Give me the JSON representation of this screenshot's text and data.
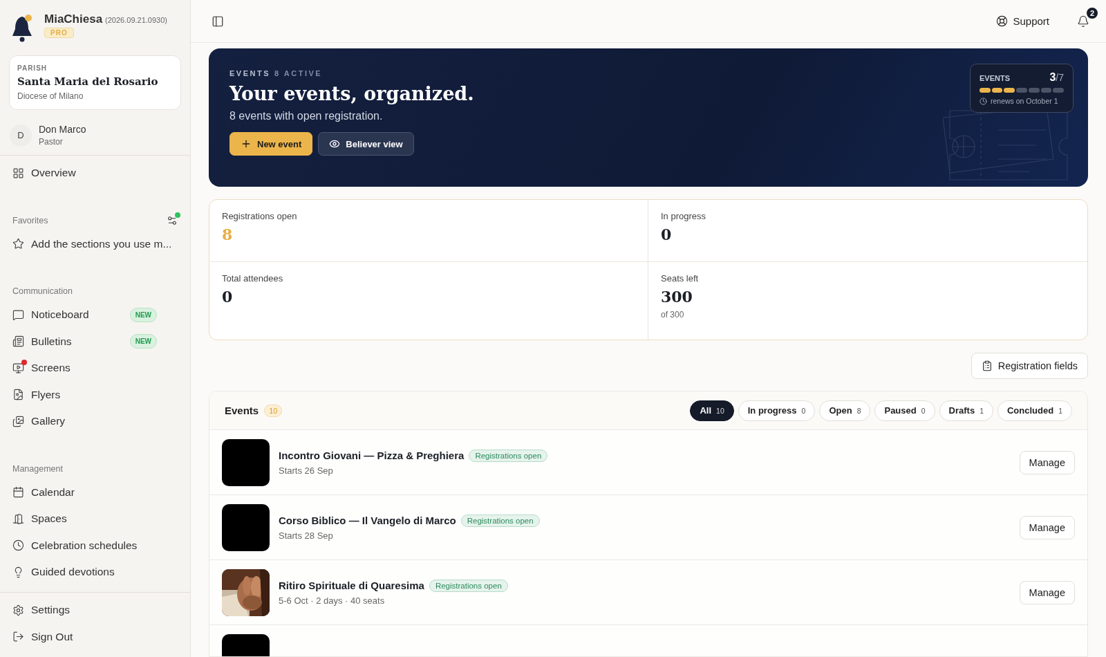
{
  "app": {
    "name": "MiaChiesa",
    "version": "(2026.09.21.0930)",
    "plan": "PRO"
  },
  "parish": {
    "label": "PARISH",
    "name": "Santa Maria del Rosario",
    "diocese": "Diocese of Milano"
  },
  "user": {
    "initial": "D",
    "name": "Don Marco",
    "role": "Pastor"
  },
  "overview": {
    "label": "Overview"
  },
  "favorites": {
    "title": "Favorites",
    "hint": "Add the sections you use m...",
    "has_update": true
  },
  "sections": [
    {
      "title": "Communication",
      "items": [
        {
          "label": "Noticeboard",
          "badge": "NEW",
          "dot": false
        },
        {
          "label": "Bulletins",
          "badge": "NEW",
          "dot": false
        },
        {
          "label": "Screens",
          "dot": true
        },
        {
          "label": "Flyers",
          "dot": false
        },
        {
          "label": "Gallery",
          "dot": false
        }
      ]
    },
    {
      "title": "Management",
      "items": [
        {
          "label": "Calendar",
          "dot": false
        },
        {
          "label": "Spaces",
          "dot": false
        },
        {
          "label": "Celebration schedules",
          "dot": false
        },
        {
          "label": "Guided devotions",
          "dot": false
        }
      ]
    }
  ],
  "footer_items": [
    {
      "label": "Settings"
    },
    {
      "label": "Sign Out"
    }
  ],
  "topbar": {
    "support": "Support",
    "notifications": "2"
  },
  "hero": {
    "eyebrow": "EVENTS",
    "eyebrow_count": "8 ACTIVE",
    "title": "Your events, organized.",
    "subtitle": "8 events with open registration.",
    "primary": "New event",
    "secondary": "Believer view",
    "usage": {
      "label": "EVENTS",
      "used": "3",
      "total": "/7",
      "segments": [
        {
          "filled": true
        },
        {
          "filled": true
        },
        {
          "filled": true
        },
        {
          "filled": false
        },
        {
          "filled": false
        },
        {
          "filled": false
        },
        {
          "filled": false
        }
      ],
      "renews": "renews on October 1"
    }
  },
  "stats": [
    {
      "label": "Registrations open",
      "value": "8",
      "highlight": true
    },
    {
      "label": "In progress",
      "value": "0",
      "highlight": false
    },
    {
      "label": "Total attendees",
      "value": "0",
      "highlight": false
    },
    {
      "label": "Seats left",
      "value": "300",
      "note": "of 300",
      "highlight": false
    }
  ],
  "registration_fields": "Registration fields",
  "events": {
    "title": "Events",
    "count": "10",
    "filters": [
      {
        "label": "All",
        "count": "10",
        "selected": true
      },
      {
        "label": "In progress",
        "count": "0",
        "selected": false
      },
      {
        "label": "Open",
        "count": "8",
        "selected": false
      },
      {
        "label": "Paused",
        "count": "0",
        "selected": false
      },
      {
        "label": "Drafts",
        "count": "1",
        "selected": false
      },
      {
        "label": "Concluded",
        "count": "1",
        "selected": false
      }
    ],
    "rows": [
      {
        "kind": "blank",
        "title": "Incontro Giovani — Pizza & Preghiera",
        "status": "Registrations open",
        "meta": "Starts 26 Sep",
        "action": "Manage"
      },
      {
        "kind": "blank",
        "title": "Corso Biblico — Il Vangelo di Marco",
        "status": "Registrations open",
        "meta": "Starts 28 Sep",
        "action": "Manage"
      },
      {
        "kind": "picture",
        "title": "Ritiro Spirituale di Quaresima",
        "status": "Registrations open",
        "meta": "5-6 Oct · 2 days · 40 seats",
        "action": "Manage"
      },
      {
        "kind": "blank"
      }
    ]
  }
}
